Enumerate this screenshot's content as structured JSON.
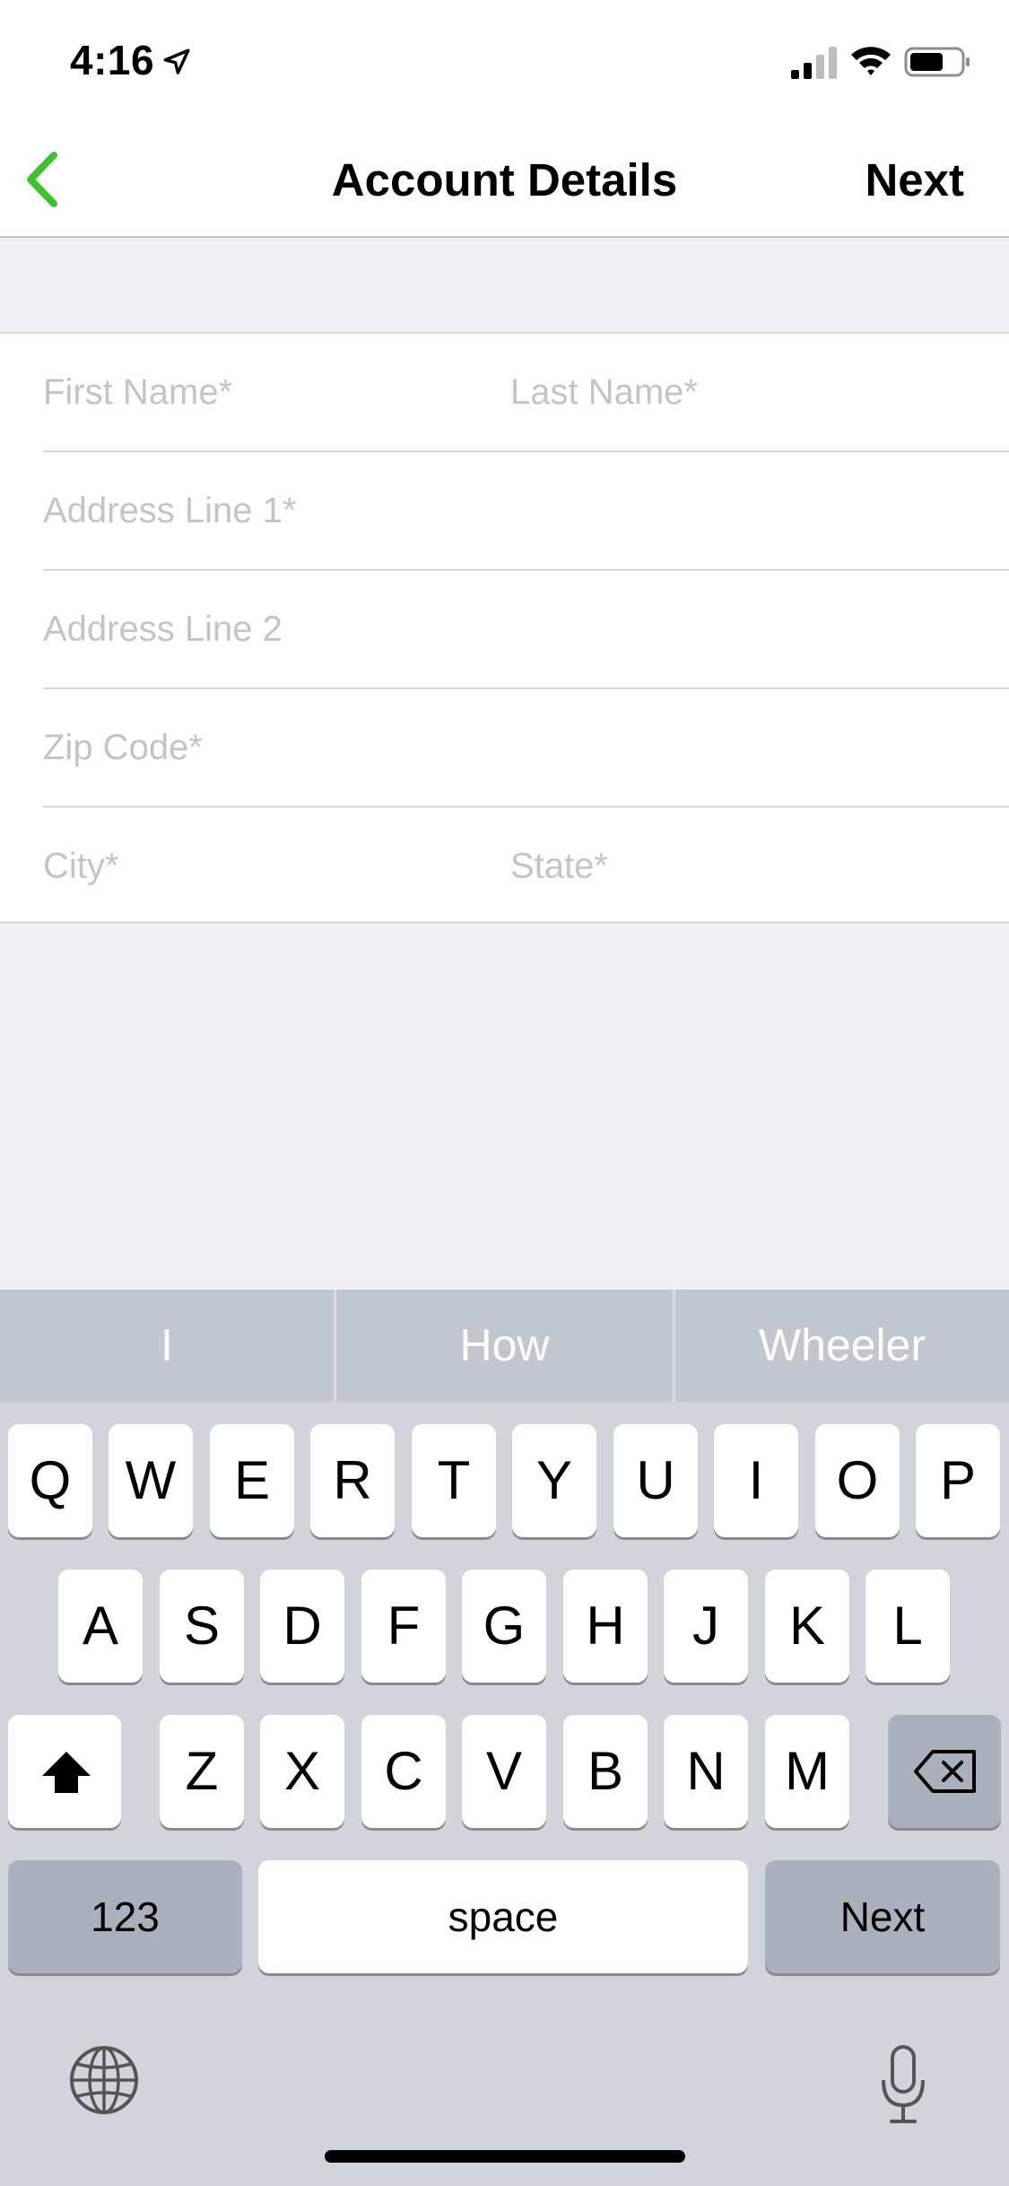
{
  "status_bar": {
    "time": "4:16"
  },
  "nav": {
    "title": "Account Details",
    "next_label": "Next"
  },
  "form": {
    "first_name_placeholder": "First Name*",
    "last_name_placeholder": "Last Name*",
    "address1_placeholder": "Address Line 1*",
    "address2_placeholder": "Address Line 2",
    "zip_placeholder": "Zip Code*",
    "city_placeholder": "City*",
    "state_placeholder": "State*"
  },
  "keyboard": {
    "suggestions": [
      "I",
      "How",
      "Wheeler"
    ],
    "row1": [
      "Q",
      "W",
      "E",
      "R",
      "T",
      "Y",
      "U",
      "I",
      "O",
      "P"
    ],
    "row2": [
      "A",
      "S",
      "D",
      "F",
      "G",
      "H",
      "J",
      "K",
      "L"
    ],
    "row3": [
      "Z",
      "X",
      "C",
      "V",
      "B",
      "N",
      "M"
    ],
    "numbers_label": "123",
    "space_label": "space",
    "return_label": "Next"
  },
  "colors": {
    "accent_green": "#3dc42b",
    "placeholder": "#c4c4c8",
    "keyboard_bg": "#d1d4db"
  },
  "icons": [
    "location-arrow-icon",
    "signal-icon",
    "wifi-icon",
    "battery-icon",
    "back-chevron-icon",
    "shift-icon",
    "delete-icon",
    "globe-icon",
    "microphone-icon"
  ]
}
